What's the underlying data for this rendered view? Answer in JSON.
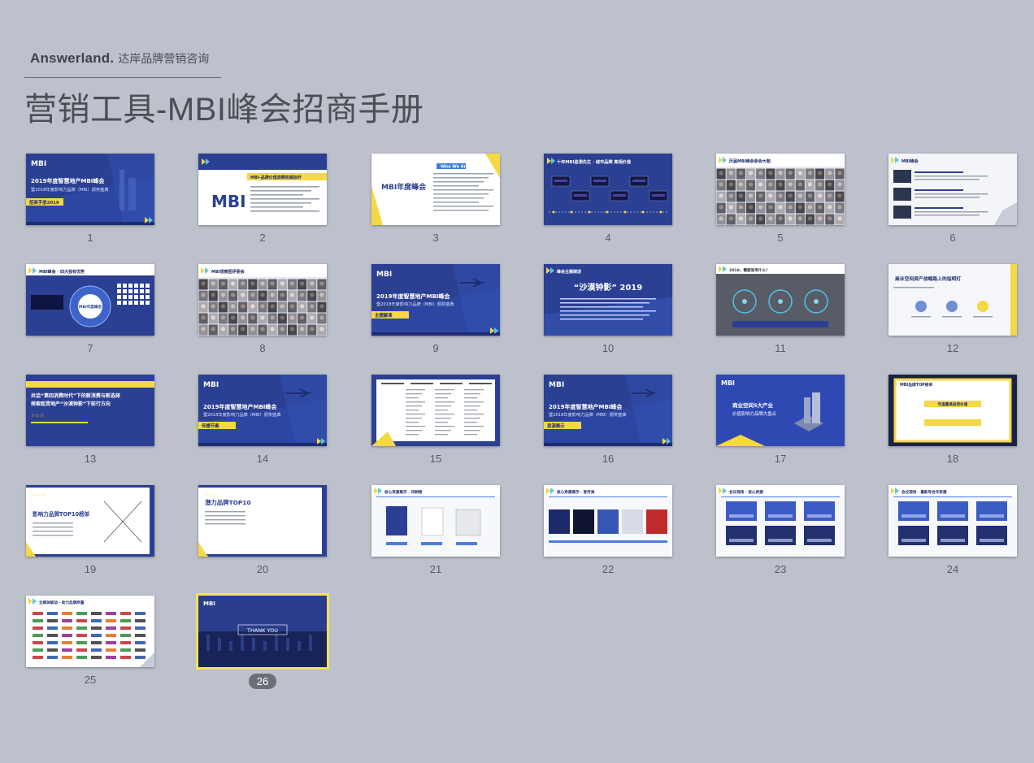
{
  "header": {
    "brand_en": "Answerland.",
    "brand_cn": "达岸品牌营销咨询",
    "title": "营销工具-MBI峰会招商手册"
  },
  "colors": {
    "background": "#bcc1cb",
    "slide_blue": "#2b3f93",
    "slide_yellow": "#f6d744",
    "selected_outline": "#f2e35a"
  },
  "slides": [
    {
      "number": "1",
      "theme": "cover-blue",
      "title": "2019年度智慧地产MBI峰会",
      "subtitle": "暨2018年度影响力品牌（MBI）颁奖盛典",
      "tag": "招商手册2019",
      "logo": "MBI"
    },
    {
      "number": "2",
      "theme": "white-logo",
      "title": "MBI-品牌价值观察权威标杆",
      "logo": "MBI"
    },
    {
      "number": "3",
      "theme": "white-yellow",
      "title": "MBI年度峰会",
      "tag": "Who We Are"
    },
    {
      "number": "4",
      "theme": "blue-timeline",
      "title": "十年MBI监测先生 · 城市品牌 真相价值"
    },
    {
      "number": "5",
      "theme": "photo-grid",
      "title": "历届MBI峰会参会大咖"
    },
    {
      "number": "6",
      "theme": "white-list",
      "title": "MBI峰会"
    },
    {
      "number": "7",
      "theme": "blue-circle",
      "title": "MBI峰会 · 四大独有优势",
      "logo": "MBI年度峰会"
    },
    {
      "number": "8",
      "theme": "photo-grid",
      "title": "MBI观察团评委会"
    },
    {
      "number": "9",
      "theme": "cover-plane",
      "title": "2019年度智慧地产MBI峰会",
      "subtitle": "暨2018年度影响力品牌（MBI）颁奖盛典",
      "tag": "主题解读",
      "logo": "MBI"
    },
    {
      "number": "10",
      "theme": "blue-quote",
      "title": "“沙漠钟影” 2019",
      "tag": "峰会主题阐述"
    },
    {
      "number": "11",
      "theme": "gray-diagram",
      "title": "2019，需要思考什么？"
    },
    {
      "number": "12",
      "theme": "white-icons",
      "title": "商业空间资产战略路上的指明灯"
    },
    {
      "number": "13",
      "theme": "blue-text",
      "title": "共话“第四消费时代”下的新消费与新选择",
      "subtitle": "探索租赁地产“沙漠钟影”下前行方向"
    },
    {
      "number": "14",
      "theme": "cover-plane",
      "title": "2019年度智慧地产MBI峰会",
      "subtitle": "暨2018年度影响力品牌（MBI）颁奖盛典",
      "tag": "传播节奏",
      "logo": "MBI"
    },
    {
      "number": "15",
      "theme": "white-table",
      "title": "日程安排"
    },
    {
      "number": "16",
      "theme": "cover-plane",
      "title": "2019年度智慧地产MBI峰会",
      "subtitle": "暨2018年度影响力品牌（MBI）颁奖盛典",
      "tag": "资源展示",
      "logo": "MBI"
    },
    {
      "number": "17",
      "theme": "blue-city",
      "title": "商业空间5大产业",
      "subtitle": "价值影响力品牌大盘点",
      "logo": "MBI"
    },
    {
      "number": "18",
      "theme": "yellow-frame",
      "title": "MBI品牌TOP榜单",
      "tag": "年度最具投资价值"
    },
    {
      "number": "19",
      "theme": "white-top10",
      "title": "影响力品牌TOP10榜单"
    },
    {
      "number": "20",
      "theme": "white-top10b",
      "title": "潜力品牌TOP10"
    },
    {
      "number": "21",
      "theme": "white-books",
      "title": "核心资源展示 · 印刷物"
    },
    {
      "number": "22",
      "theme": "white-screens",
      "title": "核心资源展示 · 宣传海"
    },
    {
      "number": "23",
      "theme": "white-photos",
      "title": "会议现场 · 核心资源"
    },
    {
      "number": "24",
      "theme": "white-photos2",
      "title": "会议现场 · 最新导合作资源"
    },
    {
      "number": "25",
      "theme": "white-logos",
      "title": "全媒体联动 · 助力品牌声量"
    },
    {
      "number": "26",
      "theme": "thank-you",
      "title": "THANK YOU",
      "logo": "MBI",
      "selected": true
    }
  ]
}
